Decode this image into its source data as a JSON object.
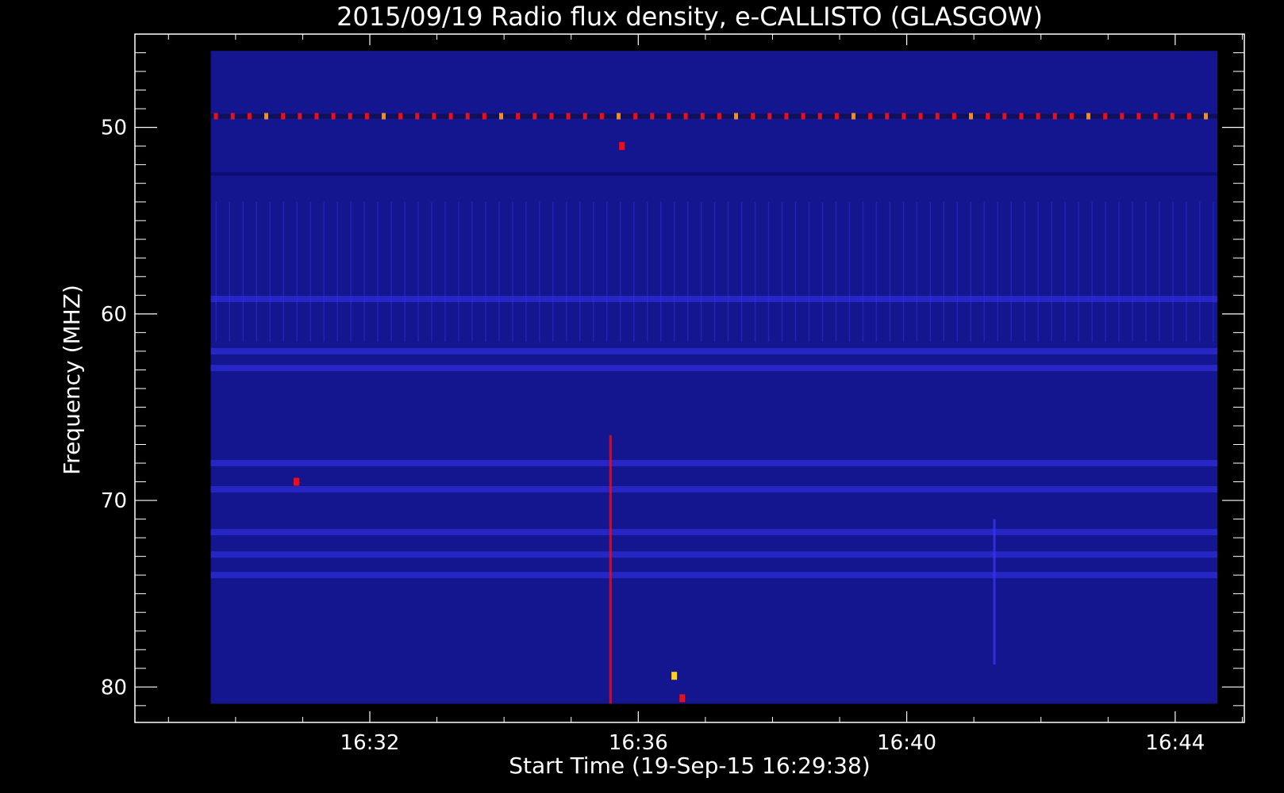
{
  "chart_data": {
    "type": "heatmap",
    "title": "2015/09/19  Radio flux density, e-CALLISTO (GLASGOW)",
    "xlabel": "Start Time (19-Sep-15 16:29:38)",
    "ylabel": "Frequency (MHZ)",
    "x_ticks": [
      "16:32",
      "16:36",
      "16:40",
      "16:44"
    ],
    "y_ticks": [
      "50",
      "60",
      "70",
      "80"
    ],
    "x_tick_minutes": [
      32,
      36,
      40,
      44
    ],
    "y_tick_values": [
      50,
      60,
      70,
      80
    ],
    "xlim_minutes": [
      28.5,
      45.03
    ],
    "ylim_mhz": [
      45.0,
      81.9
    ],
    "data_x_range_minutes": [
      29.63,
      44.63
    ],
    "data_y_range_mhz": [
      45.9,
      80.9
    ],
    "y_axis_inverted": true,
    "colormap": [
      "#000000",
      "#0d1090",
      "#2323c8",
      "#3a3aff",
      "#a02cc0",
      "#e41020",
      "#ff8c00",
      "#ffff40"
    ],
    "background_color": "#14168f",
    "horizontal_bands": [
      {
        "mhz": 49.4,
        "level": "high",
        "note": "periodic red dots"
      },
      {
        "mhz": 52.5,
        "level": "low"
      },
      {
        "mhz": 59.2,
        "level": "medium"
      },
      {
        "mhz": 62.0,
        "level": "medium"
      },
      {
        "mhz": 62.9,
        "level": "medium"
      },
      {
        "mhz": 68.0,
        "level": "medium"
      },
      {
        "mhz": 69.4,
        "level": "medium"
      },
      {
        "mhz": 71.7,
        "level": "medium"
      },
      {
        "mhz": 72.9,
        "level": "medium"
      },
      {
        "mhz": 74.0,
        "level": "medium"
      }
    ],
    "vertical_features": [
      {
        "minute": 35.58,
        "mhz_range": [
          66.5,
          80.9
        ],
        "level": "high"
      },
      {
        "minute": 41.3,
        "mhz_range": [
          71.0,
          78.8
        ],
        "level": "medium"
      }
    ],
    "bursts": [
      {
        "minute": 35.75,
        "mhz": 51.0,
        "level": "high"
      },
      {
        "minute": 36.53,
        "mhz": 79.4,
        "level": "very-high"
      },
      {
        "minute": 36.65,
        "mhz": 80.6,
        "level": "high"
      },
      {
        "minute": 30.9,
        "mhz": 69.0,
        "level": "high"
      }
    ]
  }
}
